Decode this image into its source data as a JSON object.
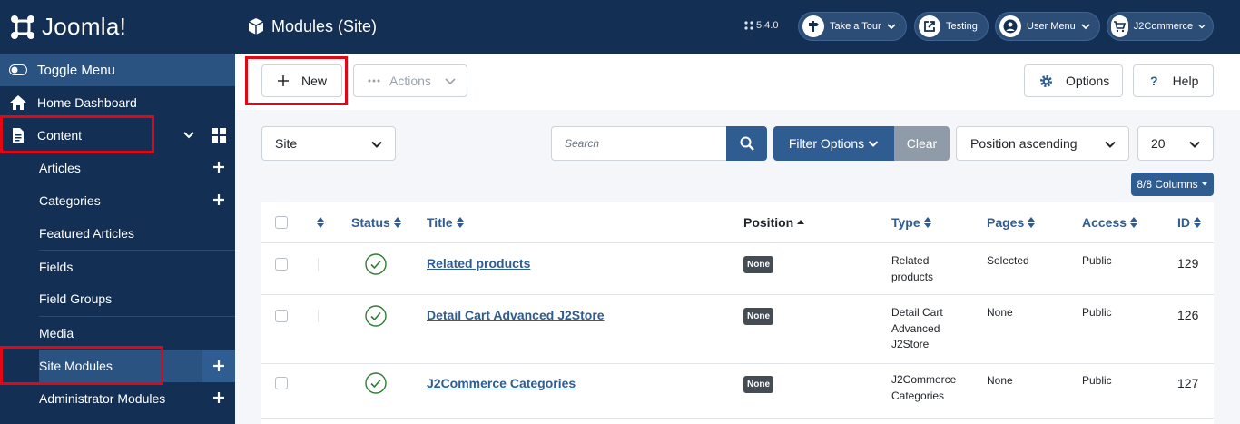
{
  "sidebar": {
    "logo_text": "Joomla!",
    "toggle_label": "Toggle Menu",
    "home_label": "Home Dashboard",
    "content_label": "Content",
    "items": [
      {
        "label": "Articles"
      },
      {
        "label": "Categories"
      },
      {
        "label": "Featured Articles"
      },
      {
        "label": "Fields"
      },
      {
        "label": "Field Groups"
      },
      {
        "label": "Media"
      },
      {
        "label": "Site Modules"
      },
      {
        "label": "Administrator Modules"
      }
    ]
  },
  "header": {
    "title": "Modules (Site)",
    "version": "5.4.0",
    "take_tour": "Take a Tour",
    "testing": "Testing",
    "user_menu": "User Menu",
    "j2commerce": "J2Commerce"
  },
  "toolbar": {
    "new_label": "New",
    "actions_label": "Actions",
    "options_label": "Options",
    "help_label": "Help"
  },
  "filters": {
    "client": "Site",
    "search_placeholder": "Search",
    "filter_options": "Filter Options",
    "clear": "Clear",
    "sort": "Position ascending",
    "limit": "20",
    "columns": "8/8 Columns"
  },
  "table": {
    "headers": {
      "status": "Status",
      "title": "Title",
      "position": "Position",
      "type": "Type",
      "pages": "Pages",
      "access": "Access",
      "id": "ID"
    },
    "rows": [
      {
        "title": "Related products",
        "position": "None",
        "type": "Related products",
        "pages": "Selected",
        "access": "Public",
        "id": "129"
      },
      {
        "title": "Detail Cart Advanced J2Store",
        "position": "None",
        "type": "Detail Cart Advanced J2Store",
        "pages": "None",
        "access": "Public",
        "id": "126"
      },
      {
        "title": "J2Commerce Categories",
        "position": "None",
        "type": "J2Commerce Categories",
        "pages": "None",
        "access": "Public",
        "id": "127"
      }
    ]
  },
  "colors": {
    "sidebar_bg": "#132f53",
    "accent": "#2f5d92",
    "highlight": "#e30613",
    "success": "#2e7d32"
  }
}
